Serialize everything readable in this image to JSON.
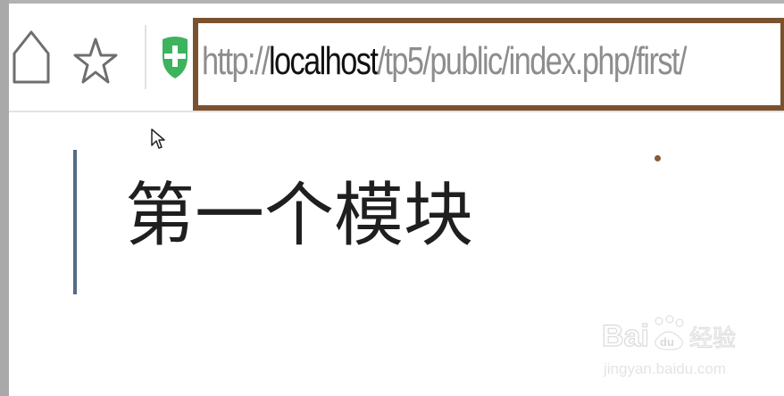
{
  "browser": {
    "url": {
      "prefix": "http://",
      "host": "localhost",
      "path": "/tp5/public/index.php/first/"
    },
    "icons": [
      "home-icon",
      "star-icon",
      "shield-icon"
    ],
    "highlight_color": "#7a5230"
  },
  "page": {
    "heading": "第一个模块"
  },
  "watermark": {
    "logo_text": "Baidu经验",
    "subtext": "jingyan.baidu.com"
  }
}
